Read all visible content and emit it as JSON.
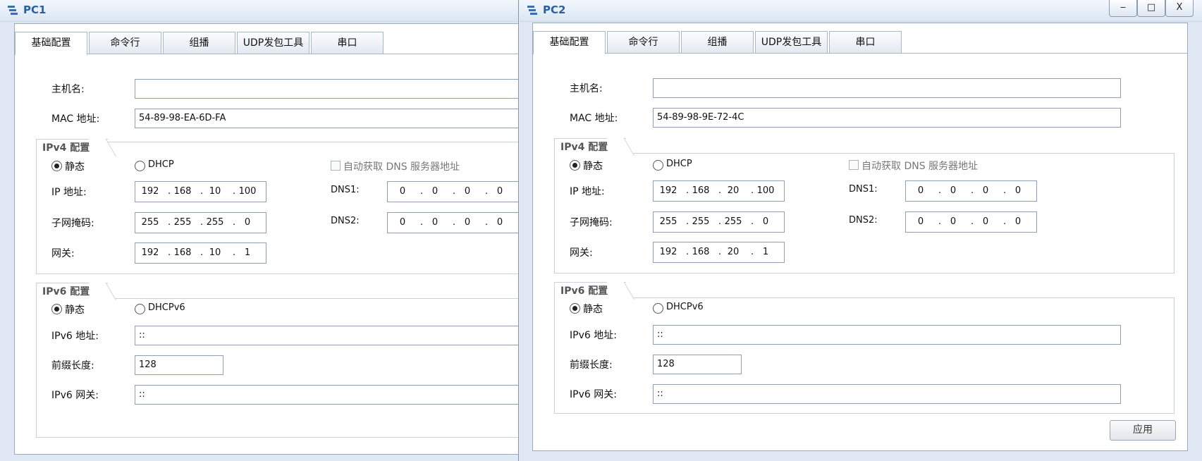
{
  "tabs": [
    "基础配置",
    "命令行",
    "组播",
    "UDP发包工具",
    "串口"
  ],
  "labels": {
    "hostname": "主机名:",
    "mac": "MAC 地址:",
    "ipv4_group": "IPv4 配置",
    "static": "静态",
    "dhcp": "DHCP",
    "auto_dns": "自动获取 DNS 服务器地址",
    "ip": "IP 地址:",
    "mask": "子网掩码:",
    "gateway": "网关:",
    "dns1": "DNS1:",
    "dns2": "DNS2:",
    "ipv6_group": "IPv6 配置",
    "dhcpv6": "DHCPv6",
    "ipv6_addr": "IPv6 地址:",
    "prefix": "前缀长度:",
    "ipv6_gw": "IPv6 网关:"
  },
  "pc1": {
    "title": "PC1",
    "hostname": "",
    "mac": "54-89-98-EA-6D-FA",
    "ip": [
      "192",
      "168",
      "10",
      "100"
    ],
    "mask": [
      "255",
      "255",
      "255",
      "0"
    ],
    "gateway": [
      "192",
      "168",
      "10",
      "1"
    ],
    "dns1": [
      "0",
      "0",
      "0",
      "0"
    ],
    "dns2": [
      "0",
      "0",
      "0",
      "0"
    ],
    "ipv6_addr": "::",
    "prefix": "128",
    "ipv6_gw": "::"
  },
  "pc2": {
    "title": "PC2",
    "controls": {
      "minimize": "‒",
      "maximize": "□",
      "close": "X"
    },
    "hostname": "",
    "mac": "54-89-98-9E-72-4C",
    "ip": [
      "192",
      "168",
      "20",
      "100"
    ],
    "mask": [
      "255",
      "255",
      "255",
      "0"
    ],
    "gateway": [
      "192",
      "168",
      "20",
      "1"
    ],
    "dns1": [
      "0",
      "0",
      "0",
      "0"
    ],
    "dns2": [
      "0",
      "0",
      "0",
      "0"
    ],
    "ipv6_addr": "::",
    "prefix": "128",
    "ipv6_gw": "::",
    "apply": "应用"
  },
  "colors": {
    "title": "#2b5f9e",
    "window_bg": "#dfe8f3",
    "panel_bg": "#ffffff"
  },
  "icons": {
    "app": "pc-network-icon",
    "radio_on": "radio-selected-icon",
    "radio_off": "radio-unselected-icon"
  }
}
